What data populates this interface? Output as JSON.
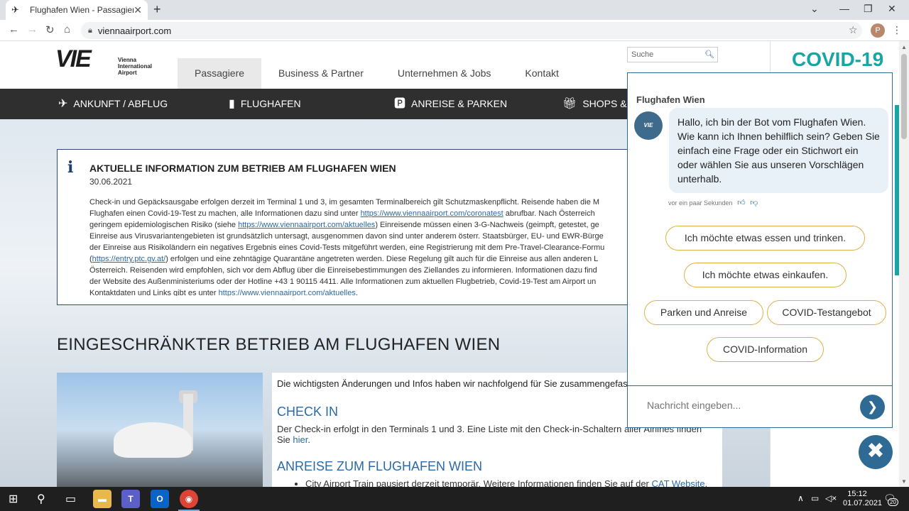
{
  "browser": {
    "tab_title": "Flughafen Wien - Passagiere",
    "tab_close": "✕",
    "new_tab": "+",
    "url": "viennaairport.com",
    "profile_initial": "P"
  },
  "site": {
    "logo_text": "VIE",
    "logo_sub": "Vienna\nInternational\nAirport",
    "top_nav": [
      "Passagiere",
      "Business & Partner",
      "Unternehmen & Jobs",
      "Kontakt"
    ],
    "search_placeholder": "Suche",
    "main_nav": [
      "ANKUNFT / ABFLUG",
      "FLUGHAFEN",
      "ANREISE & PARKEN",
      "SHOPS & R"
    ],
    "covid_banner": "COVID-19"
  },
  "info": {
    "title": "AKTUELLE INFORMATION ZUM BETRIEB AM FLUGHAFEN WIEN",
    "date": "30.06.2021",
    "line1": "Check-in und Gepäcksausgabe erfolgen derzeit im Terminal 1 und 3, im gesamten Terminalbereich gilt Schutzmaskenpflicht. Reisende haben die M",
    "line2a": "Flughafen einen Covid-19-Test zu machen, alle Informationen dazu sind unter ",
    "link1": "https://www.viennaairport.com/coronatest",
    "line2b": " abrufbar. Nach Österreich",
    "line3a": "geringem epidemiologischen Risiko (siehe ",
    "link2": "https://www.viennaairport.com/aktuelles",
    "line3b": ") Einreisende müssen einen 3-G-Nachweis (geimpft, getestet, ge",
    "line4": "Einreise aus Virusvariantengebieten ist grundsätzlich untersagt, ausgenommen davon sind unter anderem österr. Staatsbürger, EU- und EWR-Bürge",
    "line5": "der Einreise aus Risikoländern ein negatives Ergebnis eines Covid-Tests mitgeführt werden, eine Registrierung mit dem Pre-Travel-Clearance-Formu",
    "line6a": "(",
    "link3": "https://entry.ptc.gv.at/",
    "line6b": ") erfolgen und eine zehntägige Quarantäne angetreten werden. Diese Regelung gilt auch für die Einreise aus allen anderen L",
    "line7": "Österreich. Reisenden wird empfohlen, sich vor dem Abflug über die Einreisebestimmungen des Ziellandes zu informieren. Informationen dazu find",
    "line8": "der Website des Außenministeriums oder der Hotline +43 1 90115 4411. Alle Informationen zum aktuellen Flugbetrieb, Covid-19-Test am Airport un",
    "line9a": "Kontaktdaten und Links gibt es unter ",
    "link4": "https://www.viennaairport.com/aktuelles",
    "line9b": "."
  },
  "main": {
    "headline": "EINGESCHRÄNKTER BETRIEB AM FLUGHAFEN WIEN",
    "intro": "Die wichtigsten Änderungen und Infos haben wir nachfolgend für Sie zusammengefasst.",
    "checkin_title": "CHECK IN",
    "checkin_text": "Der Check-in erfolgt in den Terminals 1 und 3. Eine Liste mit den Check-in-Schaltern aller Airlines finden Sie ",
    "checkin_link": "hier",
    "checkin_end": ".",
    "anreise_title": "ANREISE ZUM FLUGHAFEN WIEN",
    "anreise_item": "City Airport Train pausiert derzeit temporär. Weitere Informationen finden Sie auf der ",
    "anreise_link": "CAT Website",
    "anreise_end": "."
  },
  "chat": {
    "title": "Flughafen Wien",
    "bot_avatar": "VIE",
    "message": "Hallo, ich bin der Bot vom Flughafen Wien. Wie kann ich Ihnen behilflich sein? Geben Sie einfach eine Frage oder ein Stichwort ein oder wählen Sie aus unseren Vorschlägen unterhalb.",
    "timestamp": "vor ein paar Sekunden",
    "suggestions": [
      "Ich möchte etwas essen und trinken.",
      "Ich möchte etwas einkaufen.",
      "Parken und Anreise",
      "COVID-Testangebot",
      "COVID-Information"
    ],
    "input_placeholder": "Nachricht eingeben...",
    "send": "❯",
    "close": "✖"
  },
  "taskbar": {
    "time": "15:12",
    "date": "01.07.2021",
    "notif_count": "20"
  }
}
